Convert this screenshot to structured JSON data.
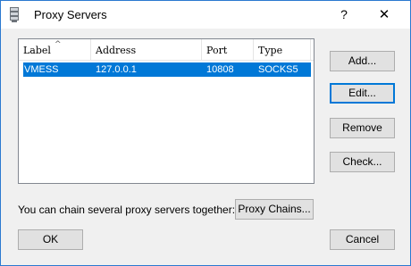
{
  "window": {
    "title": "Proxy Servers",
    "help_glyph": "?",
    "close_glyph": "✕"
  },
  "list": {
    "columns": [
      "Label",
      "Address",
      "Port",
      "Type"
    ],
    "sort_glyph": "^",
    "rows": [
      {
        "label": "VMESS",
        "address": "127.0.0.1",
        "port": "10808",
        "type": "SOCKS5",
        "selected": true
      }
    ]
  },
  "side_buttons": {
    "add": "Add...",
    "edit": "Edit...",
    "remove": "Remove",
    "check": "Check..."
  },
  "chain": {
    "hint": "You can chain several proxy servers together:",
    "button": "Proxy Chains..."
  },
  "footer": {
    "ok": "OK",
    "cancel": "Cancel"
  },
  "colors": {
    "selection": "#0078d7",
    "border": "#2b79d0"
  },
  "icons": {
    "app": "proxy-server-icon"
  }
}
